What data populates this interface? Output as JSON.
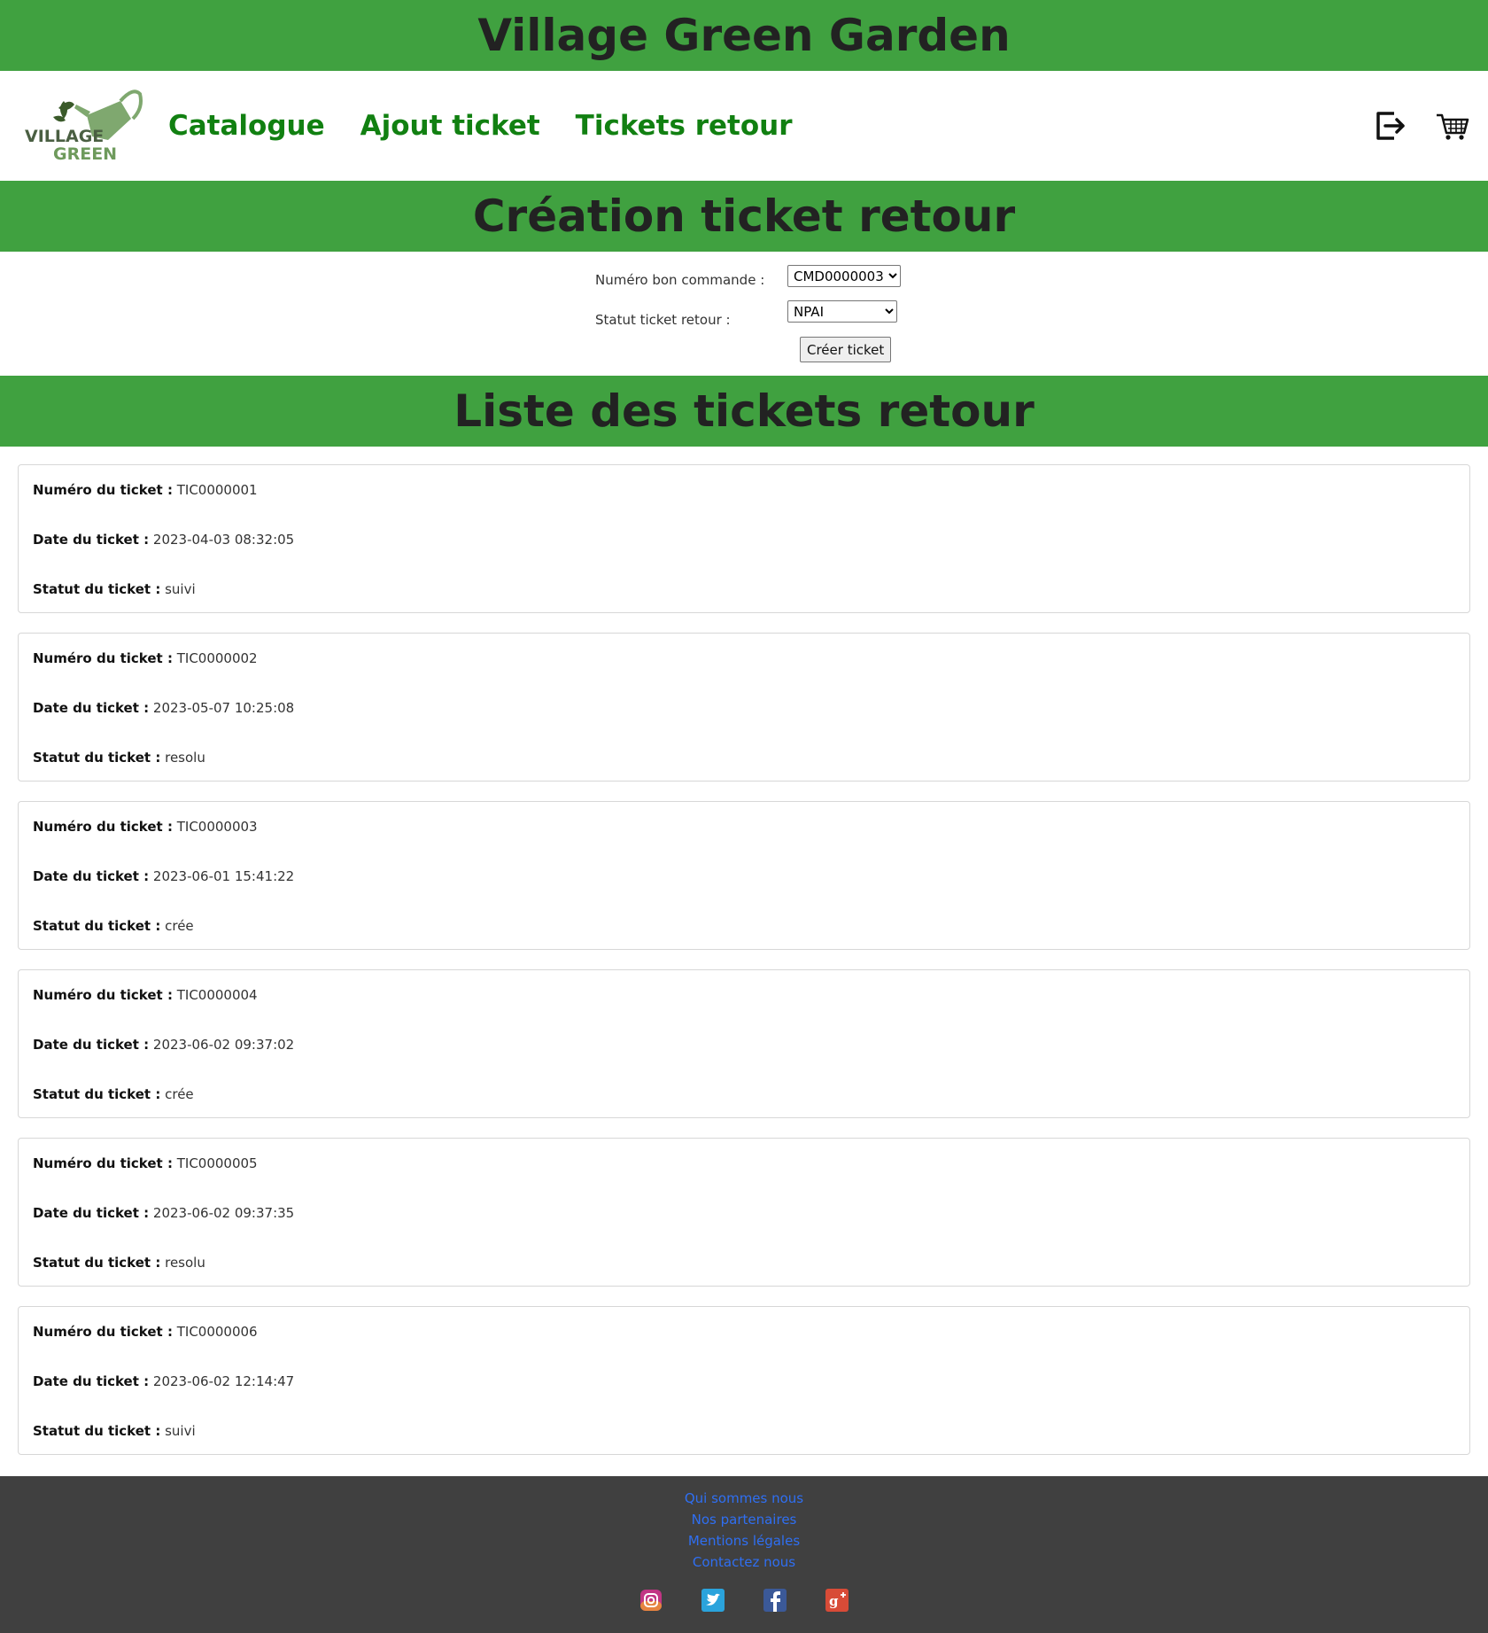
{
  "site": {
    "title": "Village Green Garden"
  },
  "nav": {
    "logo_line1": "VILLAGE",
    "logo_line2": "GREEN",
    "links": [
      "Catalogue",
      "Ajout ticket",
      "Tickets retour"
    ],
    "icons": [
      "logout-icon",
      "cart-icon"
    ]
  },
  "create": {
    "title": "Création ticket retour",
    "order_label": "Numéro bon commande :",
    "order_value": "CMD0000003",
    "status_label": "Statut ticket retour :",
    "status_value": "NPAI",
    "submit_label": "Créer ticket"
  },
  "list": {
    "title": "Liste des tickets retour",
    "number_label": "Numéro du ticket :",
    "date_label": "Date du ticket :",
    "status_label": "Statut du ticket :",
    "tickets": [
      {
        "number": "TIC0000001",
        "date": "2023-04-03 08:32:05",
        "status": "suivi"
      },
      {
        "number": "TIC0000002",
        "date": "2023-05-07 10:25:08",
        "status": "resolu"
      },
      {
        "number": "TIC0000003",
        "date": "2023-06-01 15:41:22",
        "status": "crée"
      },
      {
        "number": "TIC0000004",
        "date": "2023-06-02 09:37:02",
        "status": "crée"
      },
      {
        "number": "TIC0000005",
        "date": "2023-06-02 09:37:35",
        "status": "resolu"
      },
      {
        "number": "TIC0000006",
        "date": "2023-06-02 12:14:47",
        "status": "suivi"
      }
    ]
  },
  "footer": {
    "links": [
      "Qui sommes nous",
      "Nos partenaires",
      "Mentions légales",
      "Contactez nous"
    ],
    "social_icons": [
      "instagram-icon",
      "twitter-icon",
      "facebook-icon",
      "google-plus-icon"
    ]
  },
  "colors": {
    "band": "#40a140",
    "nav_link": "#118011",
    "footer_bg": "#404040",
    "footer_link": "#2f6ff2"
  }
}
